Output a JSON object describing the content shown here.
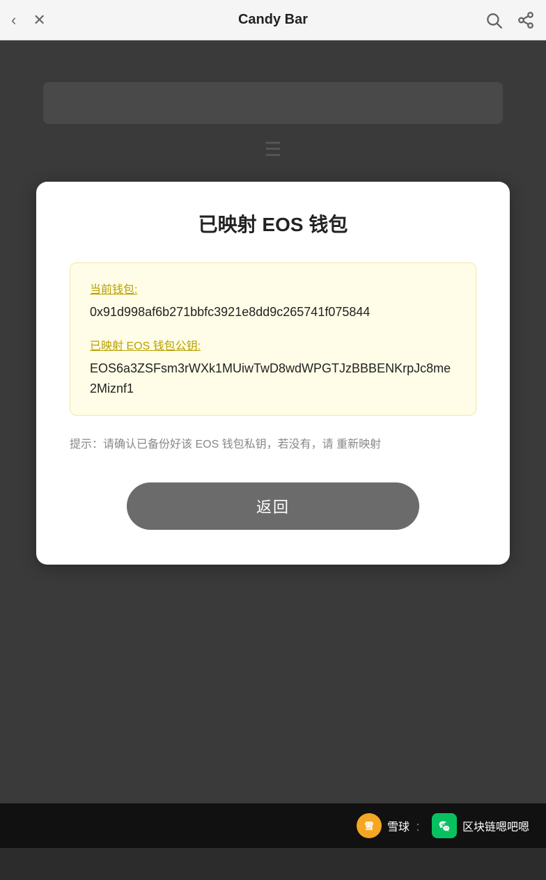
{
  "nav": {
    "title": "Candy Bar",
    "back_icon": "‹",
    "close_icon": "✕"
  },
  "card": {
    "title": "已映射 EOS 钱包",
    "info_box": {
      "wallet_label": "当前钱包:",
      "wallet_value": "0x91d998af6b271bbfc3921e8dd9c265741f075844",
      "eos_label": "已映射 EOS 钱包公钥:",
      "eos_value": "EOS6a3ZSFsm3rWXk1MUiwTwD8wdWPGTJzBBBENKrpJc8me2Miznf1"
    },
    "hint": "提示：请确认已备份好该 EOS 钱包私钥，若没有，请 重新映射",
    "button_label": "返回"
  },
  "watermark": {
    "site": "雪球",
    "divider": "：",
    "channel": "区块链嗯吧嗯"
  },
  "colors": {
    "bg_dark": "#3a3a3a",
    "card_bg": "#ffffff",
    "info_bg": "#fffde7",
    "btn_bg": "#6b6b6b",
    "label_color": "#b8a000",
    "hint_color": "#888888"
  }
}
